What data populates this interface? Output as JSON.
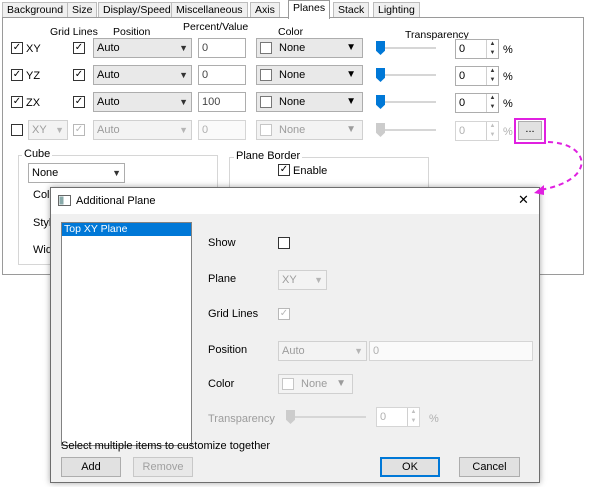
{
  "tabs": [
    "Background",
    "Size",
    "Display/Speed",
    "Miscellaneous",
    "Axis",
    "Planes",
    "Stack",
    "Lighting"
  ],
  "active_tab": "Planes",
  "headers": {
    "grid_lines": "Grid Lines",
    "position": "Position",
    "percent_value": "Percent/Value",
    "color": "Color",
    "transparency": "Transparency"
  },
  "planes": [
    {
      "label": "XY",
      "checked": "✓",
      "grid": "✓",
      "position": "Auto",
      "value": "0",
      "color": "None",
      "transparency": "0",
      "unit": "%"
    },
    {
      "label": "YZ",
      "checked": "✓",
      "grid": "✓",
      "position": "Auto",
      "value": "0",
      "color": "None",
      "transparency": "0",
      "unit": "%"
    },
    {
      "label": "ZX",
      "checked": "✓",
      "grid": "✓",
      "position": "Auto",
      "value": "100",
      "color": "None",
      "transparency": "0",
      "unit": "%"
    }
  ],
  "additional_row": {
    "plane": "XY",
    "grid": "✓",
    "position": "Auto",
    "value": "0",
    "color": "None",
    "transparency": "0",
    "unit": "%",
    "more_button": "..."
  },
  "cube": {
    "title": "Cube",
    "select": "None",
    "partial_labels": [
      "Col",
      "Styl",
      "Wid"
    ]
  },
  "plane_border": {
    "title": "Plane Border",
    "enable_label": "Enable",
    "enable_checked": "✓"
  },
  "dialog": {
    "title": "Additional Plane",
    "close": "✕",
    "list_items": [
      "Top XY Plane"
    ],
    "show_label": "Show",
    "plane_label": "Plane",
    "plane_value": "XY",
    "grid_lines_label": "Grid Lines",
    "grid_lines_mark": "✓",
    "position_label": "Position",
    "position_value": "Auto",
    "position_number": "0",
    "color_label": "Color",
    "color_value": "None",
    "transparency_label": "Transparency",
    "transparency_value": "0",
    "transparency_unit": "%",
    "hint": "Select multiple items to customize together",
    "add_button": "Add",
    "remove_button": "Remove",
    "ok_button": "OK",
    "cancel_button": "Cancel"
  },
  "colors": {
    "accent": "#0078d7",
    "highlight": "#e020e0"
  }
}
